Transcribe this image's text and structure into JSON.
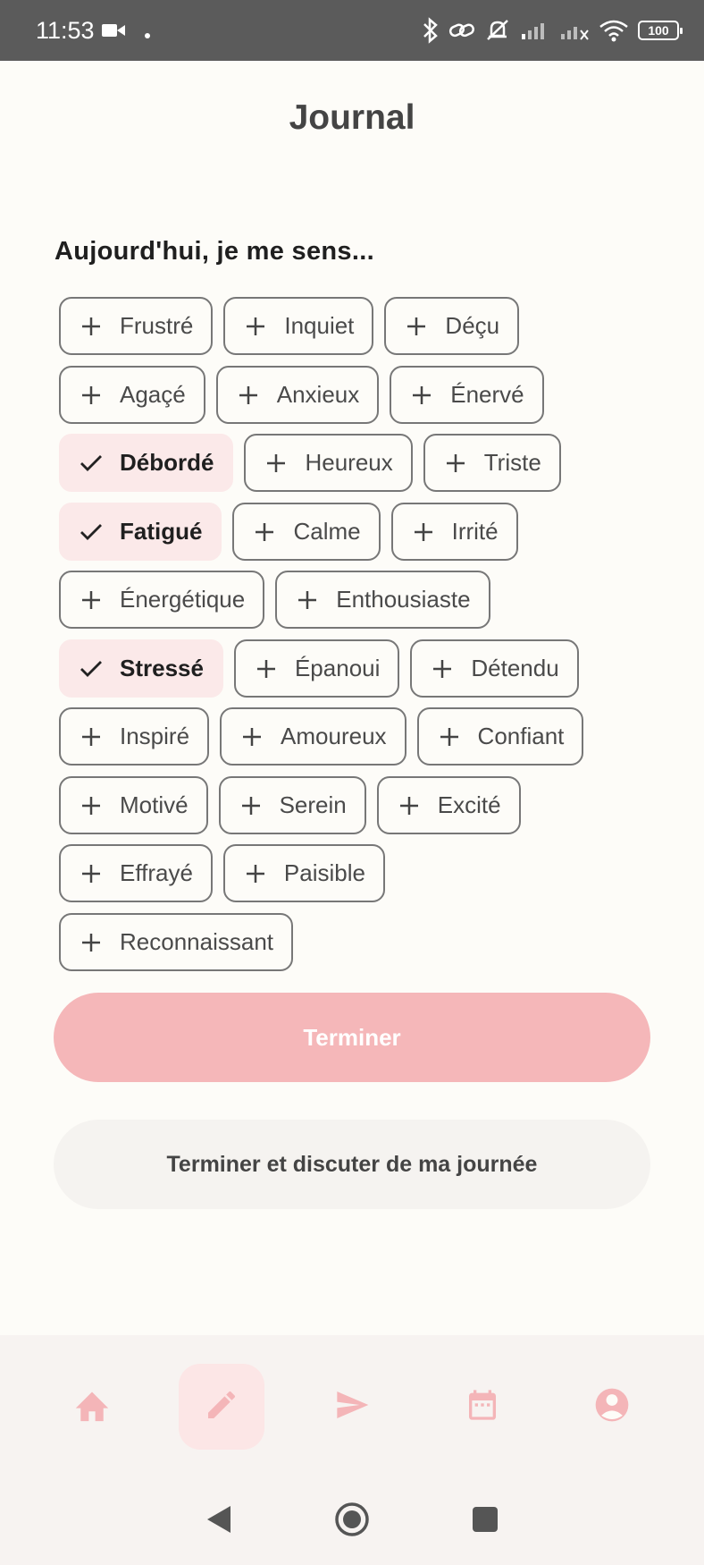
{
  "status_bar": {
    "time": "11:53",
    "battery": "100",
    "icons": [
      "video-camera-icon",
      "dot-icon",
      "bluetooth-icon",
      "link-icon",
      "notifications-off-icon",
      "signal-icon",
      "signal-off-icon",
      "wifi-icon",
      "battery-icon"
    ]
  },
  "header": {
    "title": "Journal"
  },
  "prompt": "Aujourd'hui, je me sens...",
  "emotions": {
    "r1": [
      {
        "label": "Frustré",
        "selected": false
      },
      {
        "label": "Inquiet",
        "selected": false
      },
      {
        "label": "Déçu",
        "selected": false
      }
    ],
    "r2": [
      {
        "label": "Agaçé",
        "selected": false
      },
      {
        "label": "Anxieux",
        "selected": false
      },
      {
        "label": "Énervé",
        "selected": false
      }
    ],
    "r3": [
      {
        "label": "Débordé",
        "selected": true
      },
      {
        "label": "Heureux",
        "selected": false
      },
      {
        "label": "Triste",
        "selected": false
      }
    ],
    "r4": [
      {
        "label": "Fatigué",
        "selected": true
      },
      {
        "label": "Calme",
        "selected": false
      },
      {
        "label": "Irrité",
        "selected": false
      }
    ],
    "r5": [
      {
        "label": "Énergétique",
        "selected": false
      },
      {
        "label": "Enthousiaste",
        "selected": false
      }
    ],
    "r6": [
      {
        "label": "Stressé",
        "selected": true
      },
      {
        "label": "Épanoui",
        "selected": false
      },
      {
        "label": "Détendu",
        "selected": false
      }
    ],
    "r7": [
      {
        "label": "Inspiré",
        "selected": false
      },
      {
        "label": "Amoureux",
        "selected": false
      },
      {
        "label": "Confiant",
        "selected": false
      }
    ],
    "r8": [
      {
        "label": "Motivé",
        "selected": false
      },
      {
        "label": "Serein",
        "selected": false
      },
      {
        "label": "Excité",
        "selected": false
      }
    ],
    "r9": [
      {
        "label": "Effrayé",
        "selected": false
      },
      {
        "label": "Paisible",
        "selected": false
      }
    ],
    "r10": [
      {
        "label": "Reconnaissant",
        "selected": false
      }
    ]
  },
  "actions": {
    "finish": "Terminer",
    "finish_and_chat": "Terminer et discuter de ma journée"
  },
  "bottom_nav": {
    "items": [
      {
        "icon": "home-icon",
        "active": false
      },
      {
        "icon": "pencil-icon",
        "active": true
      },
      {
        "icon": "send-icon",
        "active": false
      },
      {
        "icon": "calendar-icon",
        "active": false
      },
      {
        "icon": "account-icon",
        "active": false
      }
    ]
  },
  "colors": {
    "accent": "#f5b7b9",
    "selected_chip_bg": "#fbe9e9",
    "nav_icon": "#f4b5b8",
    "background": "#fdfcf8"
  }
}
